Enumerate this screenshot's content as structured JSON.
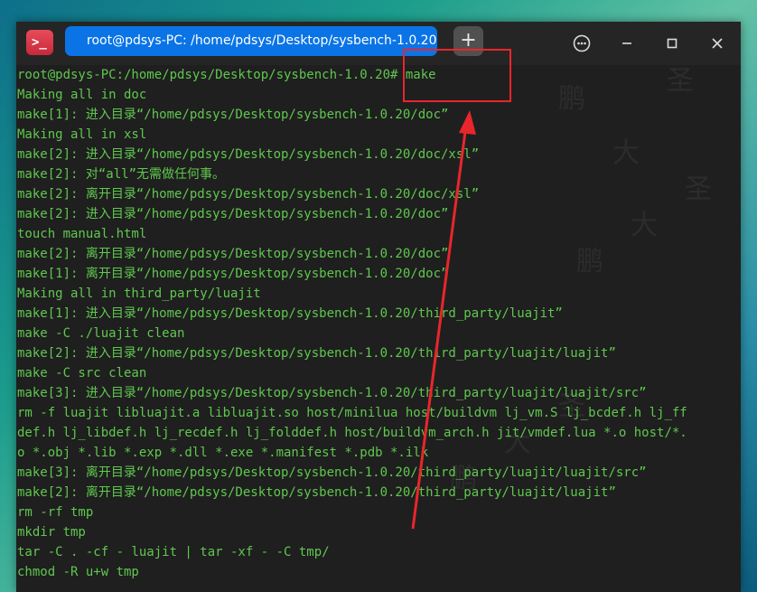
{
  "app": {
    "icon_glyph": ">_",
    "tab_title": "root@pdsys-PC: /home/pdsys/Desktop/sysbench-1.0.20",
    "new_tab_glyph": "+"
  },
  "watermark": [
    "鹏",
    "大",
    "圣",
    "鹏",
    "大",
    "圣",
    "鹏",
    "大",
    "圣"
  ],
  "terminal": {
    "lines": [
      {
        "text": "root@pdsys-PC:/home/pdsys/Desktop/sysbench-1.0.20# make",
        "bold": false
      },
      {
        "text": "Making all in doc",
        "bold": false
      },
      {
        "text": "make[1]: 进入目录“/home/pdsys/Desktop/sysbench-1.0.20/doc”",
        "bold": false
      },
      {
        "text": "Making all in xsl",
        "bold": false
      },
      {
        "text": "make[2]: 进入目录“/home/pdsys/Desktop/sysbench-1.0.20/doc/xsl”",
        "bold": false
      },
      {
        "text": "make[2]: 对“all”无需做任何事。",
        "bold": false
      },
      {
        "text": "make[2]: 离开目录“/home/pdsys/Desktop/sysbench-1.0.20/doc/xsl”",
        "bold": false
      },
      {
        "text": "make[2]: 进入目录“/home/pdsys/Desktop/sysbench-1.0.20/doc”",
        "bold": false
      },
      {
        "text": "touch manual.html",
        "bold": false
      },
      {
        "text": "make[2]: 离开目录“/home/pdsys/Desktop/sysbench-1.0.20/doc”",
        "bold": false
      },
      {
        "text": "make[1]: 离开目录“/home/pdsys/Desktop/sysbench-1.0.20/doc”",
        "bold": false
      },
      {
        "text": "Making all in third_party/luajit",
        "bold": false
      },
      {
        "text": "make[1]: 进入目录“/home/pdsys/Desktop/sysbench-1.0.20/third_party/luajit”",
        "bold": false
      },
      {
        "text": "make -C ./luajit clean",
        "bold": false
      },
      {
        "text": "make[2]: 进入目录“/home/pdsys/Desktop/sysbench-1.0.20/third_party/luajit/luajit”",
        "bold": false
      },
      {
        "text": "make -C src clean",
        "bold": false
      },
      {
        "text": "make[3]: 进入目录“/home/pdsys/Desktop/sysbench-1.0.20/third_party/luajit/luajit/src”",
        "bold": false
      },
      {
        "text": "rm -f luajit libluajit.a libluajit.so host/minilua host/buildvm lj_vm.S lj_bcdef.h lj_ff",
        "bold": false
      },
      {
        "text": "def.h lj_libdef.h lj_recdef.h lj_folddef.h host/buildvm_arch.h jit/vmdef.lua *.o host/*.",
        "bold": false
      },
      {
        "text": "o *.obj *.lib *.exp *.dll *.exe *.manifest *.pdb *.ilk",
        "bold": false
      },
      {
        "text": "make[3]: 离开目录“/home/pdsys/Desktop/sysbench-1.0.20/third_party/luajit/luajit/src”",
        "bold": false
      },
      {
        "text": "make[2]: 离开目录“/home/pdsys/Desktop/sysbench-1.0.20/third_party/luajit/luajit”",
        "bold": false
      },
      {
        "text": "rm -rf tmp",
        "bold": false
      },
      {
        "text": "mkdir tmp",
        "bold": false
      },
      {
        "text": "tar -C . -cf - luajit | tar -xf - -C tmp/",
        "bold": false
      },
      {
        "text": "chmod -R u+w tmp",
        "bold": false
      }
    ]
  },
  "colors": {
    "terminal_text": "#5fc84e",
    "terminal_bg": "#1f1f1f",
    "tab_active": "#0a74e6",
    "annotation_red": "#e8262b"
  },
  "annotation": {
    "highlight_target": "make",
    "type": "red-box-and-arrow"
  },
  "icons": {
    "menu": "more-options-icon",
    "minimize": "minimize-icon",
    "maximize": "maximize-icon",
    "close": "close-icon"
  }
}
